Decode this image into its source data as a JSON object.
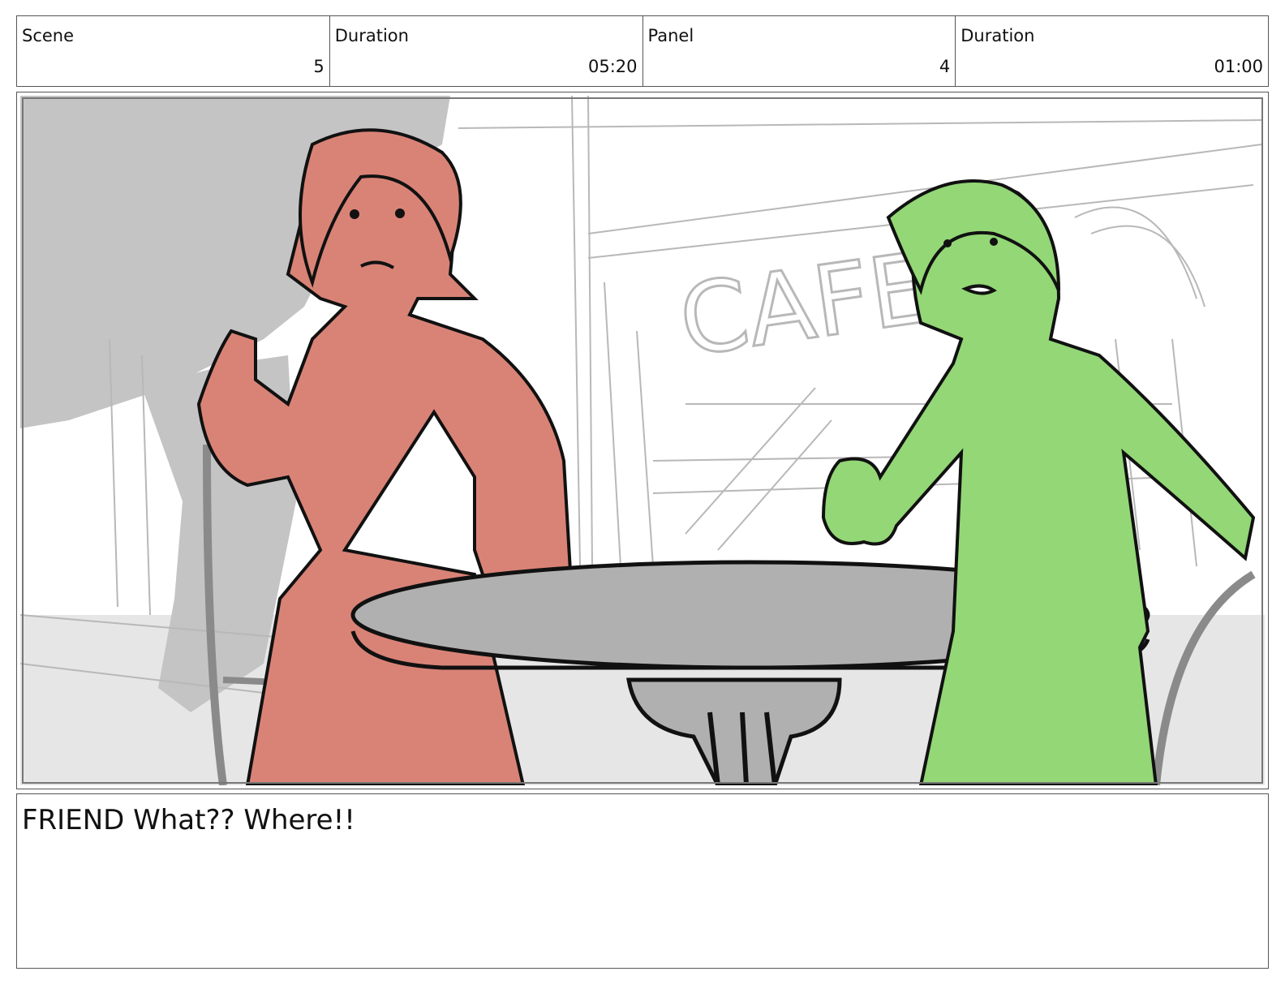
{
  "header": {
    "cells": [
      {
        "label": "Scene",
        "value": "5"
      },
      {
        "label": "Duration",
        "value": "05:20"
      },
      {
        "label": "Panel",
        "value": "4"
      },
      {
        "label": "Duration",
        "value": "01:00"
      }
    ]
  },
  "panel": {
    "sign_text": "CAFE",
    "colors": {
      "left_character": "#d98377",
      "right_character": "#93d776",
      "table": "#b0b0b0",
      "background_tree": "#c4c4c4",
      "ground": "#e6e6e6",
      "line": "#111111",
      "sketch": "#b8b8b8"
    }
  },
  "caption": {
    "text": "FRIEND What?? Where!!"
  }
}
